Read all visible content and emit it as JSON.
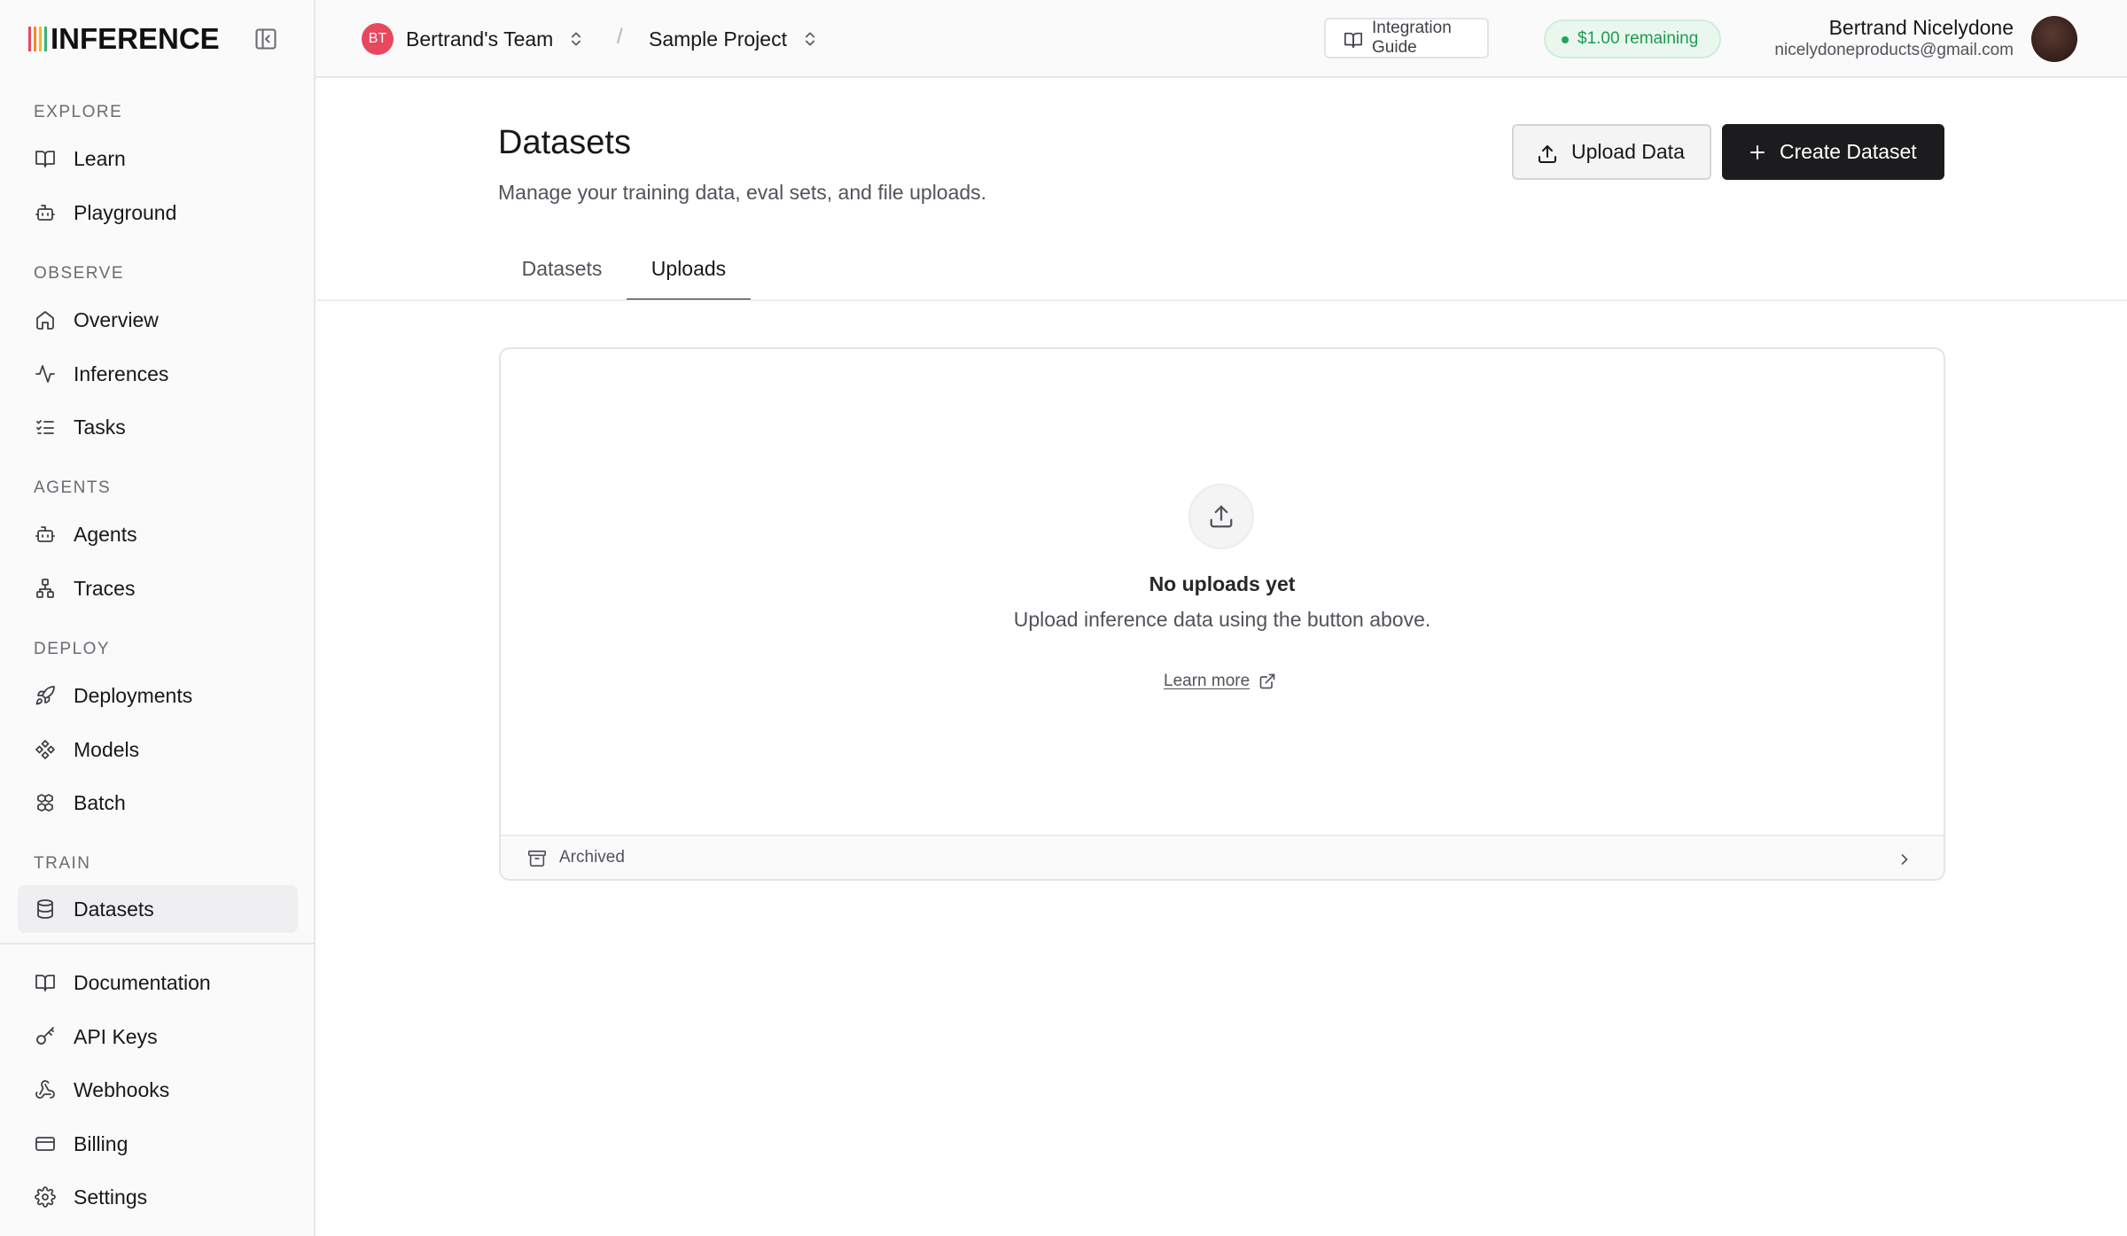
{
  "brand": {
    "logo_text": "INFERENCE",
    "bar_colors": [
      "#e8485e",
      "#f08a2c",
      "#f2b92c",
      "#3ab07a"
    ]
  },
  "sidebar": {
    "sections": [
      {
        "label": "EXPLORE",
        "items": [
          {
            "label": "Learn",
            "icon": "book-icon"
          },
          {
            "label": "Playground",
            "icon": "bot-icon"
          }
        ]
      },
      {
        "label": "OBSERVE",
        "items": [
          {
            "label": "Overview",
            "icon": "home-icon"
          },
          {
            "label": "Inferences",
            "icon": "activity-icon"
          },
          {
            "label": "Tasks",
            "icon": "list-checks-icon"
          }
        ]
      },
      {
        "label": "AGENTS",
        "items": [
          {
            "label": "Agents",
            "icon": "bot-icon"
          },
          {
            "label": "Traces",
            "icon": "network-icon"
          }
        ]
      },
      {
        "label": "DEPLOY",
        "items": [
          {
            "label": "Deployments",
            "icon": "rocket-icon"
          },
          {
            "label": "Models",
            "icon": "components-icon"
          },
          {
            "label": "Batch",
            "icon": "boxes-icon"
          }
        ]
      },
      {
        "label": "TRAIN",
        "items": [
          {
            "label": "Datasets",
            "icon": "database-icon",
            "active": true
          }
        ]
      }
    ],
    "footer_items": [
      {
        "label": "Documentation",
        "icon": "book-icon"
      },
      {
        "label": "API Keys",
        "icon": "key-icon"
      },
      {
        "label": "Webhooks",
        "icon": "webhook-icon"
      },
      {
        "label": "Billing",
        "icon": "credit-card-icon"
      },
      {
        "label": "Settings",
        "icon": "gear-icon"
      }
    ]
  },
  "header": {
    "team": {
      "initials": "BT",
      "name": "Bertrand's Team",
      "avatar_color": "#e8485e"
    },
    "separator": "/",
    "project": {
      "name": "Sample Project"
    },
    "integration_guide_label": "Integration Guide",
    "credits": {
      "text": "$1.00 remaining",
      "color": "#1f9a52"
    },
    "user": {
      "name": "Bertrand Nicelydone",
      "email": "nicelydoneproducts@gmail.com"
    }
  },
  "main": {
    "title": "Datasets",
    "subtitle": "Manage your training data, eval sets, and file uploads.",
    "upload_button_label": "Upload Data",
    "create_button_label": "Create Dataset",
    "tabs": [
      {
        "label": "Datasets",
        "active": false
      },
      {
        "label": "Uploads",
        "active": true
      }
    ],
    "empty_state": {
      "title": "No uploads yet",
      "description": "Upload inference data using the button above.",
      "link_label": "Learn more"
    },
    "archived_label": "Archived"
  }
}
